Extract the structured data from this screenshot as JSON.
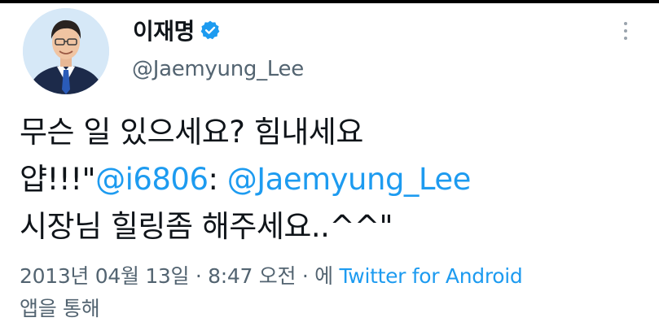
{
  "user": {
    "display_name": "이재명",
    "handle": "@Jaemyung_Lee",
    "verified": true
  },
  "tweet": {
    "line1": "무슨 일 있으세요? 힘내세요",
    "line2_prefix": "얍!!!\"",
    "mention1": "@i6806",
    "colon": ": ",
    "mention2": "@Jaemyung_Lee",
    "line3": "시장님 힐링좀 해주세요..^^\""
  },
  "meta": {
    "timestamp": "2013년 04월 13일 · 8:47 오전 · 에 ",
    "source": "Twitter for Android",
    "suffix": "앱을 통해"
  },
  "icons": {
    "verified": "verified-badge-icon",
    "more": "more-options-icon"
  },
  "colors": {
    "link": "#1d9bf0",
    "secondary_text": "#536471",
    "primary_text": "#0f1419"
  }
}
